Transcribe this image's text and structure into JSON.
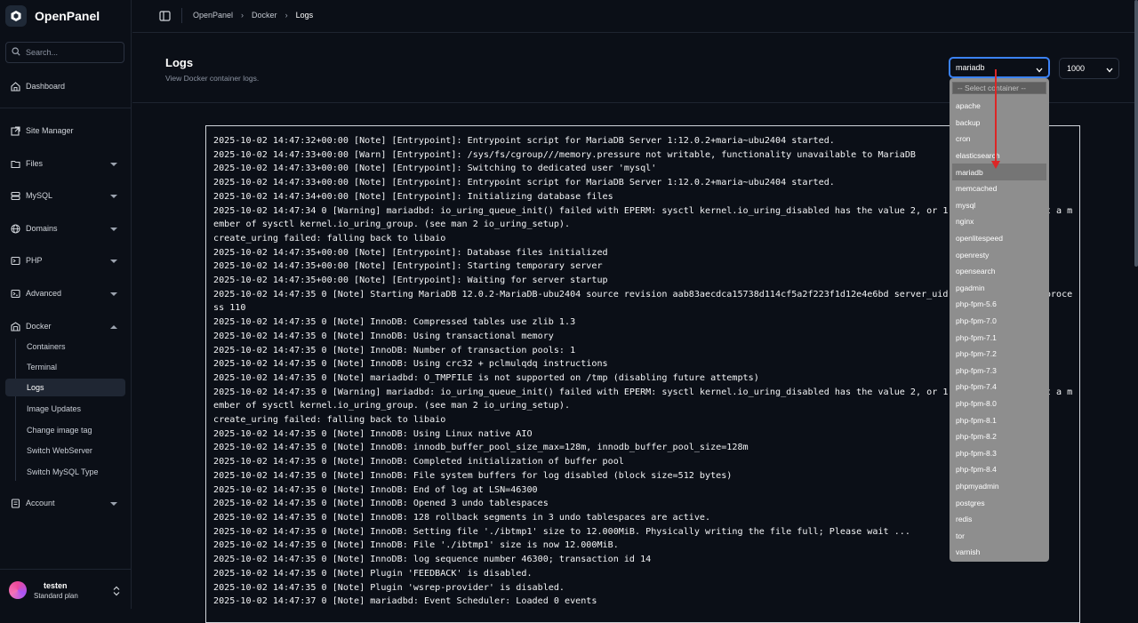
{
  "brand": {
    "name": "OpenPanel"
  },
  "sidebar": {
    "search_placeholder": "Search...",
    "items": [
      {
        "label": "Dashboard",
        "icon": "home-icon"
      },
      {
        "label": "Site Manager",
        "icon": "external-link-icon"
      },
      {
        "label": "Files",
        "icon": "folder-icon"
      },
      {
        "label": "MySQL",
        "icon": "database-icon"
      },
      {
        "label": "Domains",
        "icon": "globe-icon"
      },
      {
        "label": "PHP",
        "icon": "terminal-icon"
      },
      {
        "label": "Advanced",
        "icon": "code-icon"
      },
      {
        "label": "Docker",
        "icon": "docker-icon"
      },
      {
        "label": "Account",
        "icon": "account-icon"
      }
    ],
    "docker_sub": [
      "Containers",
      "Terminal",
      "Logs",
      "Image Updates",
      "Change image tag",
      "Switch WebServer",
      "Switch MySQL Type"
    ],
    "active_sub": "Logs"
  },
  "user": {
    "name": "testen",
    "plan": "Standard plan"
  },
  "breadcrumb": [
    "OpenPanel",
    "Docker",
    "Logs"
  ],
  "page": {
    "title": "Logs",
    "subtitle": "View Docker container logs."
  },
  "container_select": {
    "value": "mariadb"
  },
  "lines_select": {
    "value": "1000"
  },
  "dropdown": {
    "placeholder": "-- Select container --",
    "options": [
      "apache",
      "backup",
      "cron",
      "elasticsearch",
      "mariadb",
      "memcached",
      "mysql",
      "nginx",
      "openlitespeed",
      "openresty",
      "opensearch",
      "pgadmin",
      "php-fpm-5.6",
      "php-fpm-7.0",
      "php-fpm-7.1",
      "php-fpm-7.2",
      "php-fpm-7.3",
      "php-fpm-7.4",
      "php-fpm-8.0",
      "php-fpm-8.1",
      "php-fpm-8.2",
      "php-fpm-8.3",
      "php-fpm-8.4",
      "phpmyadmin",
      "postgres",
      "redis",
      "tor",
      "varnish"
    ],
    "selected": "mariadb"
  },
  "annotation_color": "#dc2626",
  "logs": [
    "2025-10-02 14:47:32+00:00 [Note] [Entrypoint]: Entrypoint script for MariaDB Server 1:12.0.2+maria~ubu2404 started.",
    "2025-10-02 14:47:33+00:00 [Warn] [Entrypoint]: /sys/fs/cgroup///memory.pressure not writable, functionality unavailable to MariaDB",
    "2025-10-02 14:47:33+00:00 [Note] [Entrypoint]: Switching to dedicated user 'mysql'",
    "2025-10-02 14:47:33+00:00 [Note] [Entrypoint]: Entrypoint script for MariaDB Server 1:12.0.2+maria~ubu2404 started.",
    "2025-10-02 14:47:34+00:00 [Note] [Entrypoint]: Initializing database files",
    "2025-10-02 14:47:34 0 [Warning] mariadbd: io_uring_queue_init() failed with EPERM: sysctl kernel.io_uring_disabled has the value 2, or 1 and the ... is not a member of sysctl kernel.io_uring_group. (see man 2 io_uring_setup).",
    "create_uring failed: falling back to libaio",
    "2025-10-02 14:47:35+00:00 [Note] [Entrypoint]: Database files initialized",
    "2025-10-02 14:47:35+00:00 [Note] [Entrypoint]: Starting temporary server",
    "2025-10-02 14:47:35+00:00 [Note] [Entrypoint]: Waiting for server startup",
    "2025-10-02 14:47:35 0 [Note] Starting MariaDB 12.0.2-MariaDB-ubu2404 source revision aab83aecdca15738d114cf5a2f223f1d12e4e6bd server_uid y8+3mZe... w= as process 110",
    "2025-10-02 14:47:35 0 [Note] InnoDB: Compressed tables use zlib 1.3",
    "2025-10-02 14:47:35 0 [Note] InnoDB: Using transactional memory",
    "2025-10-02 14:47:35 0 [Note] InnoDB: Number of transaction pools: 1",
    "2025-10-02 14:47:35 0 [Note] InnoDB: Using crc32 + pclmulqdq instructions",
    "2025-10-02 14:47:35 0 [Note] mariadbd: O_TMPFILE is not supported on /tmp (disabling future attempts)",
    "2025-10-02 14:47:35 0 [Warning] mariadbd: io_uring_queue_init() failed with EPERM: sysctl kernel.io_uring_disabled has the value 2, or 1 and the ... is not a member of sysctl kernel.io_uring_group. (see man 2 io_uring_setup).",
    "create_uring failed: falling back to libaio",
    "2025-10-02 14:47:35 0 [Note] InnoDB: Using Linux native AIO",
    "2025-10-02 14:47:35 0 [Note] InnoDB: innodb_buffer_pool_size_max=128m, innodb_buffer_pool_size=128m",
    "2025-10-02 14:47:35 0 [Note] InnoDB: Completed initialization of buffer pool",
    "2025-10-02 14:47:35 0 [Note] InnoDB: File system buffers for log disabled (block size=512 bytes)",
    "2025-10-02 14:47:35 0 [Note] InnoDB: End of log at LSN=46300",
    "2025-10-02 14:47:35 0 [Note] InnoDB: Opened 3 undo tablespaces",
    "2025-10-02 14:47:35 0 [Note] InnoDB: 128 rollback segments in 3 undo tablespaces are active.",
    "2025-10-02 14:47:35 0 [Note] InnoDB: Setting file './ibtmp1' size to 12.000MiB. Physically writing the file full; Please wait ...",
    "2025-10-02 14:47:35 0 [Note] InnoDB: File './ibtmp1' size is now 12.000MiB.",
    "2025-10-02 14:47:35 0 [Note] InnoDB: log sequence number 46300; transaction id 14",
    "2025-10-02 14:47:35 0 [Note] Plugin 'FEEDBACK' is disabled.",
    "2025-10-02 14:47:35 0 [Note] Plugin 'wsrep-provider' is disabled.",
    "2025-10-02 14:47:37 0 [Note] mariadbd: Event Scheduler: Loaded 0 events"
  ]
}
